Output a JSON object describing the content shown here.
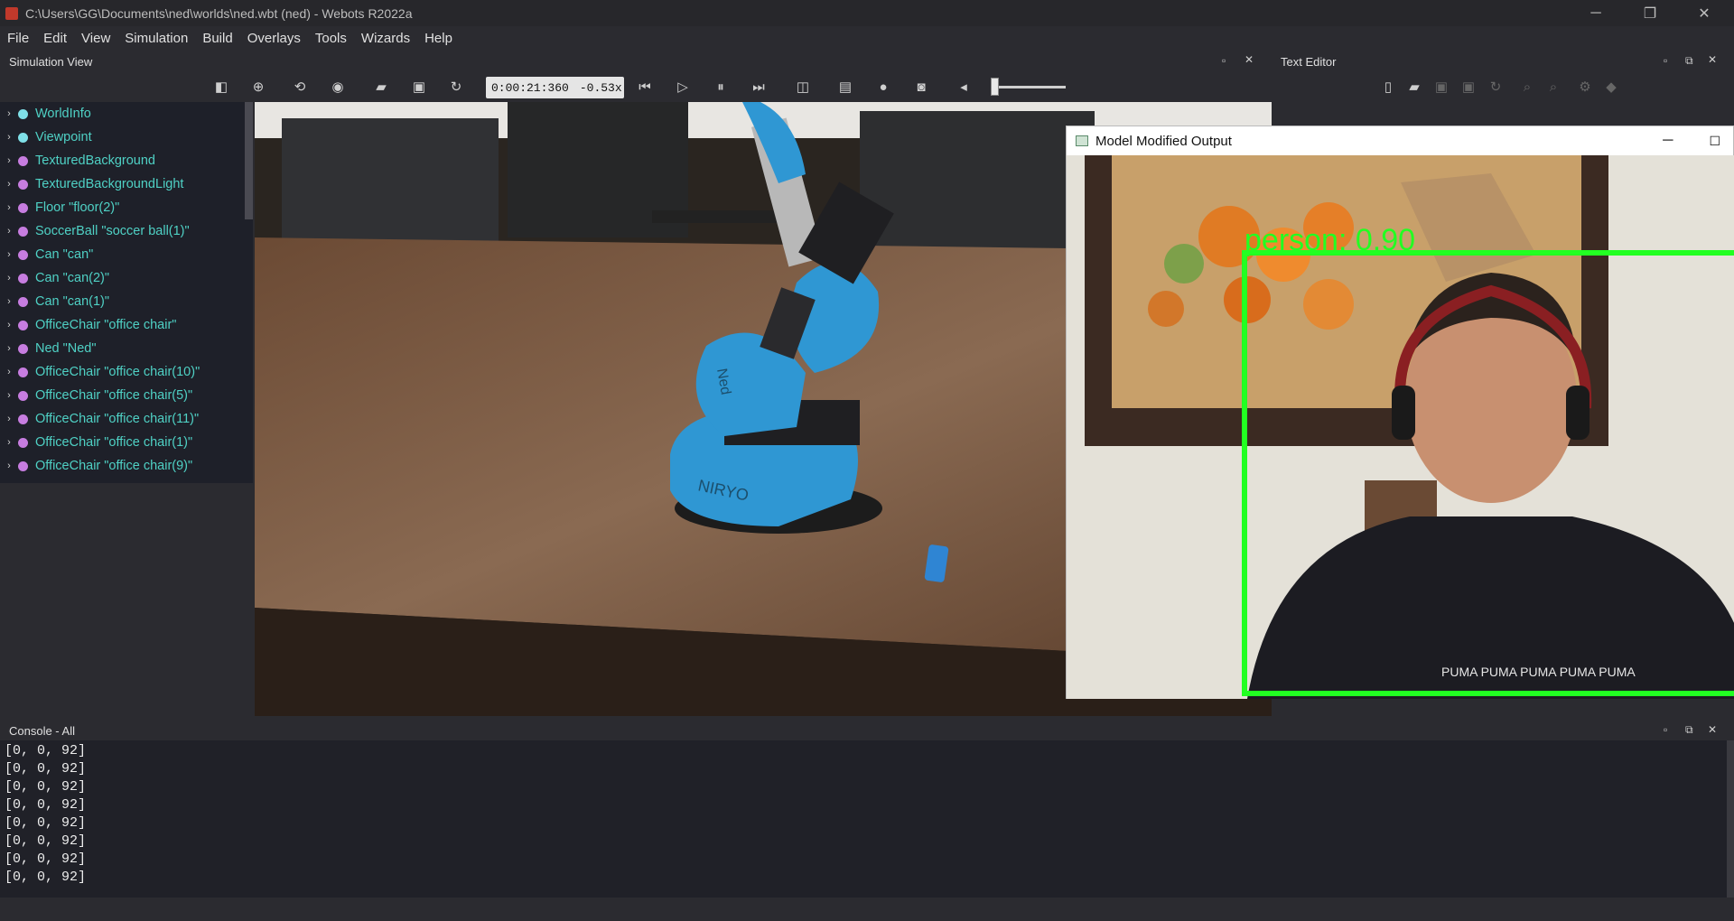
{
  "window": {
    "title": "C:\\Users\\GG\\Documents\\ned\\worlds\\ned.wbt (ned) - Webots R2022a",
    "controls": {
      "minimize": "─",
      "restore": "❐",
      "close": "✕"
    }
  },
  "menu": [
    "File",
    "Edit",
    "View",
    "Simulation",
    "Build",
    "Overlays",
    "Tools",
    "Wizards",
    "Help"
  ],
  "simulation_view": {
    "title": "Simulation View",
    "time": "0:00:21:360",
    "separator": "-",
    "speed": "0.53x"
  },
  "text_editor": {
    "title": "Text Editor"
  },
  "scene_tree": [
    {
      "label": "WorldInfo",
      "dot": "#7fe0e8"
    },
    {
      "label": "Viewpoint",
      "dot": "#7fe0e8"
    },
    {
      "label": "TexturedBackground",
      "dot": "#c77de0"
    },
    {
      "label": "TexturedBackgroundLight",
      "dot": "#c77de0"
    },
    {
      "label": "Floor \"floor(2)\"",
      "dot": "#c77de0"
    },
    {
      "label": "SoccerBall \"soccer ball(1)\"",
      "dot": "#c77de0"
    },
    {
      "label": "Can \"can\"",
      "dot": "#c77de0"
    },
    {
      "label": "Can \"can(2)\"",
      "dot": "#c77de0"
    },
    {
      "label": "Can \"can(1)\"",
      "dot": "#c77de0"
    },
    {
      "label": "OfficeChair \"office chair\"",
      "dot": "#c77de0"
    },
    {
      "label": "Ned \"Ned\"",
      "dot": "#c77de0"
    },
    {
      "label": "OfficeChair \"office chair(10)\"",
      "dot": "#c77de0"
    },
    {
      "label": "OfficeChair \"office chair(5)\"",
      "dot": "#c77de0"
    },
    {
      "label": "OfficeChair \"office chair(11)\"",
      "dot": "#c77de0"
    },
    {
      "label": "OfficeChair \"office chair(1)\"",
      "dot": "#c77de0"
    },
    {
      "label": "OfficeChair \"office chair(9)\"",
      "dot": "#c77de0"
    }
  ],
  "viewport_3d": {
    "robot_brand": "NIRYO",
    "robot_name": "Ned"
  },
  "camera_window": {
    "title": "Model Modified Output",
    "detection_label": "person: 0.90",
    "shirt_text": "PUMA PUMA PUMA PUMA PUMA"
  },
  "console": {
    "title": "Console - All",
    "lines": [
      "[0, 0, 92]",
      "[0, 0, 92]",
      "[0, 0, 92]",
      "[0, 0, 92]",
      "[0, 0, 92]",
      "[0, 0, 92]",
      "[0, 0, 92]",
      "[0, 0, 92]"
    ]
  },
  "icons": {
    "toolbar": [
      "toggle-panel-icon",
      "add-node-icon",
      "rotate-view-icon",
      "eye-icon",
      "open-file-icon",
      "save-icon",
      "reload-icon",
      "step-back-icon",
      "step-icon",
      "pause-icon",
      "fast-forward-icon",
      "cube-view-icon",
      "record-film-icon",
      "record-dot-icon",
      "camera-icon",
      "mute-icon"
    ],
    "editor": [
      "new-file-icon",
      "open-file-icon",
      "save-icon",
      "save-as-icon",
      "revert-icon",
      "find-icon",
      "replace-icon",
      "settings-icon",
      "tag-icon"
    ]
  },
  "colors": {
    "accent_tree_text": "#4fd1c5",
    "detection_box": "#22ff22"
  }
}
